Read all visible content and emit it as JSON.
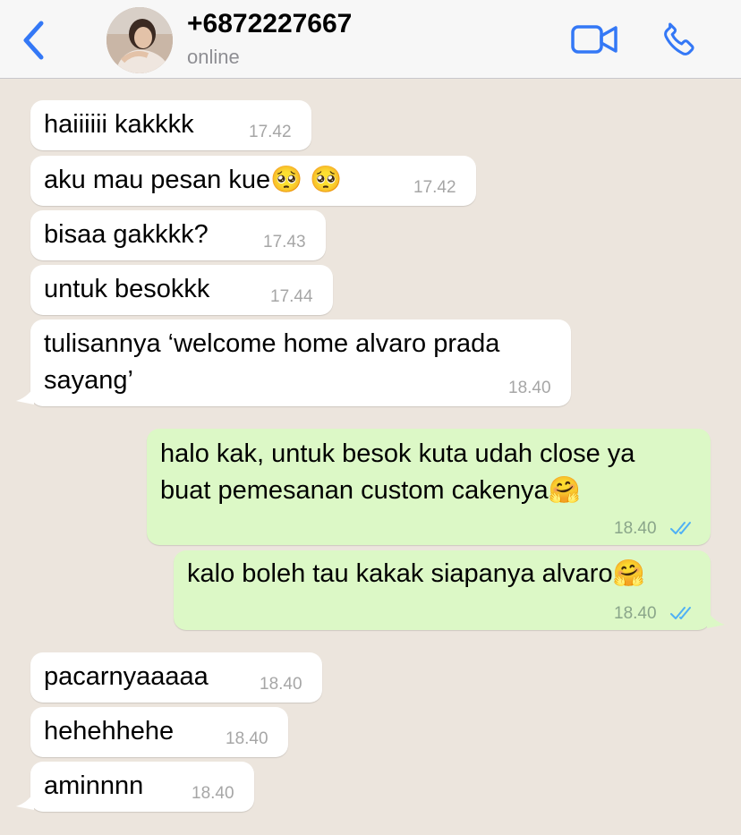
{
  "header": {
    "contact_name": "+6872227667",
    "status": "online"
  },
  "colors": {
    "accent": "#3478f6",
    "incoming_bubble": "#ffffff",
    "outgoing_bubble": "#dcf8c6",
    "chat_background": "#ece5dd",
    "read_ticks": "#4fb0f5"
  },
  "messages": [
    {
      "direction": "incoming",
      "text": "haiiiiii kakkkk",
      "time": "17.42"
    },
    {
      "direction": "incoming",
      "text": "aku mau pesan kue🥺 🥺",
      "time": "17.42"
    },
    {
      "direction": "incoming",
      "text": "bisaa gakkkk?",
      "time": "17.43"
    },
    {
      "direction": "incoming",
      "text": "untuk besokkk",
      "time": "17.44"
    },
    {
      "direction": "incoming",
      "text": "tulisannya ‘welcome home alvaro prada\nsayang’",
      "time": "18.40"
    },
    {
      "direction": "outgoing",
      "text": "halo kak, untuk besok kuta udah close ya\nbuat pemesanan custom cakenya🤗",
      "time": "18.40",
      "status": "read"
    },
    {
      "direction": "outgoing",
      "text": "kalo boleh tau kakak siapanya alvaro🤗",
      "time": "18.40",
      "status": "read"
    },
    {
      "direction": "incoming",
      "text": "pacarnyaaaaa",
      "time": "18.40"
    },
    {
      "direction": "incoming",
      "text": "hehehhehe",
      "time": "18.40"
    },
    {
      "direction": "incoming",
      "text": "aminnnn",
      "time": "18.40"
    }
  ]
}
